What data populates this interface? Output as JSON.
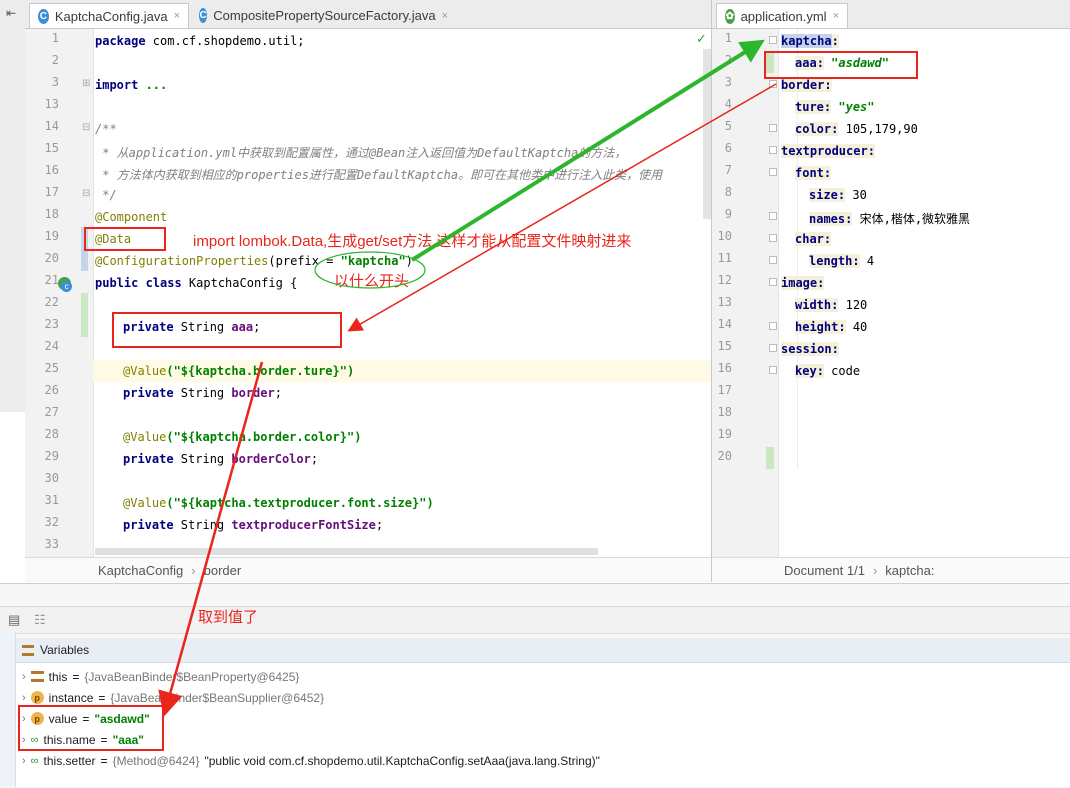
{
  "left_tabs": [
    {
      "label": "KaptchaConfig.java",
      "icon": "class-icon",
      "close": "×"
    },
    {
      "label": "CompositePropertySourceFactory.java",
      "icon": "class-icon",
      "close": "×"
    }
  ],
  "right_tabs": [
    {
      "label": "application.yml",
      "icon": "spring-leaf-icon",
      "close": "×"
    }
  ],
  "java_lines": [
    {
      "n": "1"
    },
    {
      "n": "2"
    },
    {
      "n": "3"
    },
    {
      "n": "13"
    },
    {
      "n": "14"
    },
    {
      "n": "15"
    },
    {
      "n": "16"
    },
    {
      "n": "17"
    },
    {
      "n": "18"
    },
    {
      "n": "19"
    },
    {
      "n": "20"
    },
    {
      "n": "21"
    },
    {
      "n": "22"
    },
    {
      "n": "23"
    },
    {
      "n": "24"
    },
    {
      "n": "25"
    },
    {
      "n": "26"
    },
    {
      "n": "27"
    },
    {
      "n": "28"
    },
    {
      "n": "29"
    },
    {
      "n": "30"
    },
    {
      "n": "31"
    },
    {
      "n": "32"
    },
    {
      "n": "33"
    }
  ],
  "java_code": {
    "l1_kw": "package",
    "l1_rest": " com.cf.shopdemo.util;",
    "l3_kw": "import",
    "l3_rest": " ...",
    "l14": "/**",
    "l15": " * 从application.yml中获取到配置属性，通过@Bean注入返回值为DefaultKaptcha的方法，",
    "l16": " * 方法体内获取到相应的properties进行配置DefaultKaptcha。即可在其他类中进行注入此类，使用",
    "l17": " */",
    "l18": "@Component",
    "l19": "@Data",
    "l20_ann": "@ConfigurationProperties",
    "l20_mid": "(prefix = ",
    "l20_str": "\"kaptcha\"",
    "l20_end": ")",
    "l21_kw": "public class",
    "l21_rest": " KaptchaConfig {",
    "l23_kw": "private",
    "l23_type": " String ",
    "l23_fld": "aaa",
    "l23_end": ";",
    "l25_ann": "@Value",
    "l25_str": "(\"${kaptcha.border.ture}\")",
    "l26_kw": "private",
    "l26_type": " String ",
    "l26_fld": "border",
    "l26_end": ";",
    "l28_ann": "@Value",
    "l28_str": "(\"${kaptcha.border.color}\")",
    "l29_kw": "private",
    "l29_type": " String ",
    "l29_fld": "borderColor",
    "l29_end": ";",
    "l31_ann": "@Value",
    "l31_str": "(\"${kaptcha.textproducer.font.size}\")",
    "l32_kw": "private",
    "l32_type": " String ",
    "l32_fld": "textproducerFontSize",
    "l32_end": ";"
  },
  "yaml_lines": [
    "1",
    "2",
    "3",
    "4",
    "5",
    "6",
    "7",
    "8",
    "9",
    "10",
    "11",
    "12",
    "13",
    "14",
    "15",
    "16",
    "17",
    "18",
    "19",
    "20"
  ],
  "yaml_code": {
    "y1": "kaptcha",
    "y2_key": "aaa",
    "y2_val": "\"asdawd\"",
    "y3": "border",
    "y4_key": "ture",
    "y4_val": "\"yes\"",
    "y5_key": "color",
    "y5_val": "105,179,90",
    "y6": "textproducer",
    "y7": "font",
    "y8_key": "size",
    "y8_val": "30",
    "y9_key": "names",
    "y9_val": "宋体,楷体,微软雅黑",
    "y10": "char",
    "y11_key": "length",
    "y11_val": "4",
    "y12": "image",
    "y13_key": "width",
    "y13_val": "120",
    "y14_key": "height",
    "y14_val": "40",
    "y15": "session",
    "y16_key": "key",
    "y16_val": "code"
  },
  "left_breadcrumb": [
    "KaptchaConfig",
    "border"
  ],
  "right_breadcrumb": [
    "Document 1/1",
    "kaptcha:"
  ],
  "variables_panel": {
    "title": "Variables",
    "rows": [
      {
        "name": "this",
        "value": "{JavaBeanBinder$BeanProperty@6425}"
      },
      {
        "name": "instance",
        "value": "{JavaBeanBinder$BeanSupplier@6452}"
      },
      {
        "name": "value",
        "value": "\"asdawd\""
      },
      {
        "name": "this.name",
        "value": "\"aaa\""
      },
      {
        "name": "this.setter",
        "value": "{Method@6424}",
        "extra": "\"public void com.cf.shopdemo.util.KaptchaConfig.setAaa(java.lang.String)\""
      }
    ]
  },
  "annotations": {
    "lombok_note": "import lombok.Data,生成get/set方法,这样才能从配置文件映射进来",
    "prefix_note": "以什么开头",
    "got_value_note": "取到值了"
  },
  "colors": {
    "annotation_red": "#e8261b",
    "arrow_green": "#2db52d",
    "keyword": "#000080",
    "string": "#008000"
  }
}
